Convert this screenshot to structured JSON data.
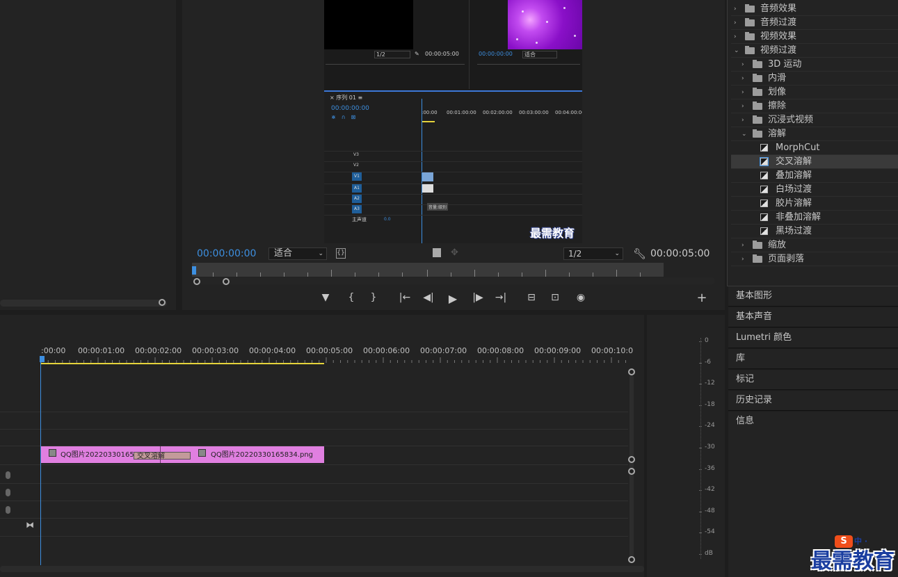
{
  "source_monitor_embedded": {
    "res": "1/2",
    "duration": "00:00:05:00",
    "timecode": "00:00:00:00",
    "fit": "适合"
  },
  "embedded_sequence": {
    "tab": "序列 01",
    "timecode": "00:00:00:00",
    "ruler": [
      ":00:00",
      "00:01:00:00",
      "00:02:00:00",
      "00:03:00:00",
      "00:04:00:00"
    ],
    "tracks": [
      "V3",
      "V2",
      "V1",
      "A1",
      "A2",
      "A3"
    ],
    "master": "主声道",
    "master_value": "0.0",
    "tooltip": "音量:级别",
    "watermark": "最需教育"
  },
  "program_monitor": {
    "timecode": "00:00:00:00",
    "fit": "适合",
    "resolution": "1/2",
    "duration": "00:00:05:00"
  },
  "transport": {
    "marker": "▼",
    "in": "{",
    "out": "}",
    "go_in": "|←",
    "step_back": "◀|",
    "play": "▶",
    "step_fwd": "|▶",
    "go_out": "→|",
    "lift": "⊟",
    "extract": "⊡",
    "export_frame": "◉",
    "add": "+"
  },
  "effects_tree": [
    {
      "label": "音频效果",
      "level": 0,
      "type": "folder",
      "expanded": false
    },
    {
      "label": "音频过渡",
      "level": 0,
      "type": "folder",
      "expanded": false
    },
    {
      "label": "视频效果",
      "level": 0,
      "type": "folder",
      "expanded": false
    },
    {
      "label": "视频过渡",
      "level": 0,
      "type": "folder",
      "expanded": true
    },
    {
      "label": "3D 运动",
      "level": 1,
      "type": "folder",
      "expanded": false
    },
    {
      "label": "内滑",
      "level": 1,
      "type": "folder",
      "expanded": false
    },
    {
      "label": "划像",
      "level": 1,
      "type": "folder",
      "expanded": false
    },
    {
      "label": "擦除",
      "level": 1,
      "type": "folder",
      "expanded": false
    },
    {
      "label": "沉浸式视频",
      "level": 1,
      "type": "folder",
      "expanded": false
    },
    {
      "label": "溶解",
      "level": 1,
      "type": "folder",
      "expanded": true
    },
    {
      "label": "MorphCut",
      "level": 2,
      "type": "effect"
    },
    {
      "label": "交叉溶解",
      "level": 2,
      "type": "effect",
      "selected": true
    },
    {
      "label": "叠加溶解",
      "level": 2,
      "type": "effect"
    },
    {
      "label": "白场过渡",
      "level": 2,
      "type": "effect"
    },
    {
      "label": "胶片溶解",
      "level": 2,
      "type": "effect"
    },
    {
      "label": "非叠加溶解",
      "level": 2,
      "type": "effect"
    },
    {
      "label": "黑场过渡",
      "level": 2,
      "type": "effect"
    },
    {
      "label": "缩放",
      "level": 1,
      "type": "folder",
      "expanded": false
    },
    {
      "label": "页面剥落",
      "level": 1,
      "type": "folder",
      "expanded": false
    }
  ],
  "side_panels": [
    "基本图形",
    "基本声音",
    "Lumetri 颜色",
    "库",
    "标记",
    "历史记录",
    "信息"
  ],
  "timeline": {
    "ruler": [
      ":00:00",
      "00:00:01:00",
      "00:00:02:00",
      "00:00:03:00",
      "00:00:04:00",
      "00:00:05:00",
      "00:00:06:00",
      "00:00:07:00",
      "00:00:08:00",
      "00:00:09:00",
      "00:00:10:0"
    ],
    "clip1": "QQ图片2022033016583",
    "clip2": "QQ图片20220330165834.png",
    "transition": "交叉溶解"
  },
  "meter_scale": [
    "0",
    "-6",
    "-12",
    "-18",
    "-24",
    "-30",
    "-36",
    "-42",
    "-48",
    "-54",
    "dB"
  ],
  "watermark": {
    "text": "最需教育",
    "logo": "S",
    "logo_tag": "中 ·"
  },
  "colors": {
    "accent": "#3d8fe0",
    "clip": "#e07fe0",
    "transition": "#c39a9a",
    "work_area": "#e5d33b"
  }
}
